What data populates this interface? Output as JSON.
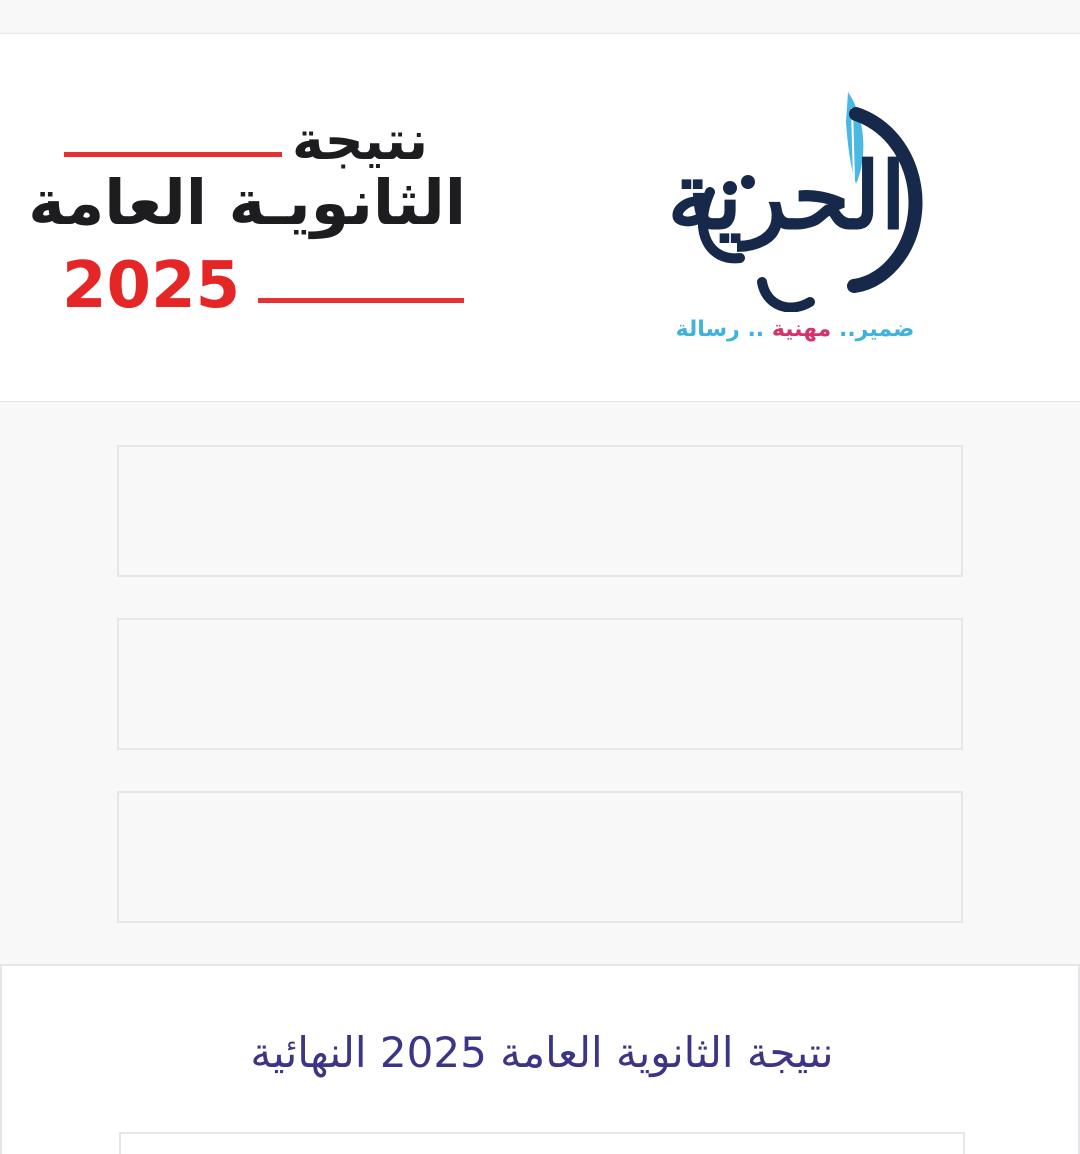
{
  "header": {
    "promo": {
      "line1": "نتيجة",
      "line2": "الثانويـة العامة",
      "year": "2025"
    },
    "brand": {
      "name": "الحرية",
      "tagline_part1": "ضمير..",
      "tagline_part2": "مهنية",
      "tagline_part3": ".. رسالة"
    }
  },
  "card": {
    "title": "نتيجة الثانوية العامة 2025 النهائية"
  },
  "colors": {
    "accent_red": "#e52626",
    "brand_navy": "#17294a",
    "brand_blue": "#3fb3dd",
    "brand_pink": "#d8316b",
    "title_purple": "#3c3586"
  }
}
